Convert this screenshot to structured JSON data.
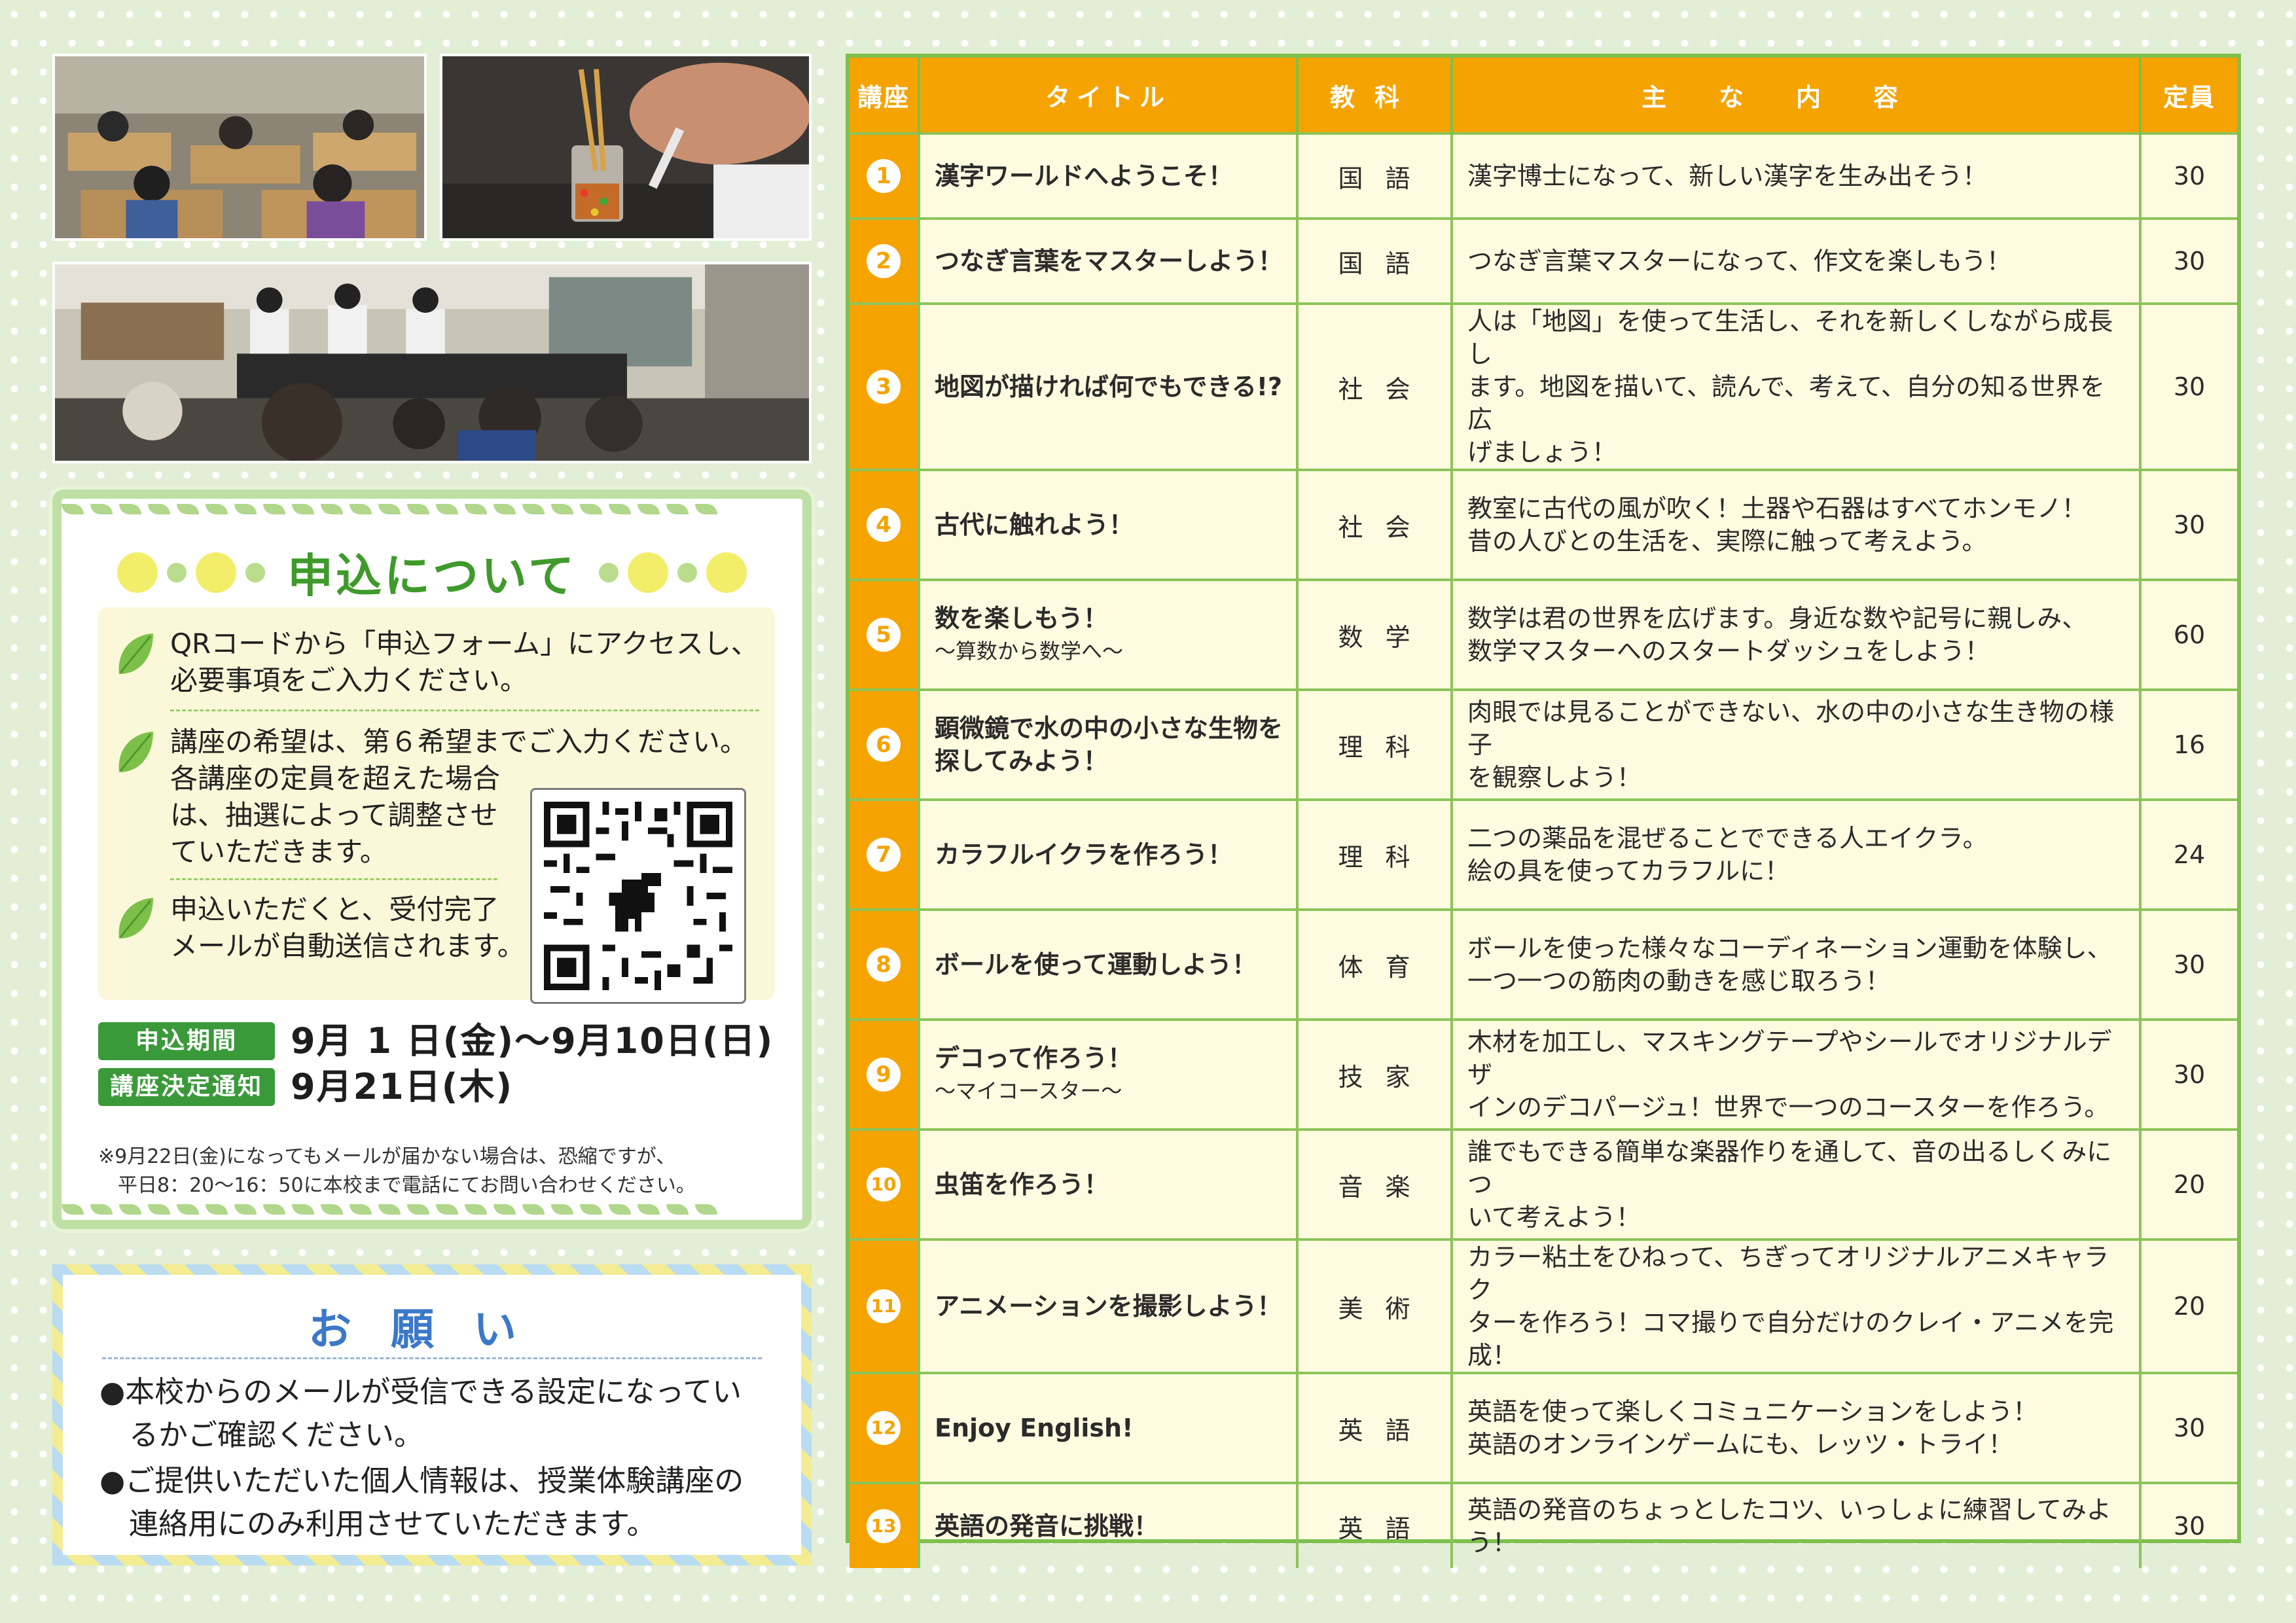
{
  "apply": {
    "title": "申込について",
    "instructions": [
      [
        "QRコードから「申込フォーム」にアクセスし、",
        "必要事項をご入力ください。"
      ],
      [
        "講座の希望は、第６希望までご入力ください。",
        "各講座の定員を超えた場合",
        "は、抽選によって調整させ",
        "ていただきます。"
      ],
      [
        "申込いただくと、受付完了",
        "メールが自動送信されます。"
      ]
    ],
    "period_label": "申込期間",
    "period_value": "9月 1 日(金)～9月10日(日)",
    "notify_label": "講座決定通知",
    "notify_value": "9月21日(木)",
    "notice": [
      "※9月22日(金)になってもメールが届かない場合は、恐縮ですが、",
      "　平日8：20～16：50に本校まで電話にてお問い合わせください。"
    ]
  },
  "request": {
    "title": "お願い",
    "items": [
      [
        "●本校からのメールが受信できる設定になってい",
        "るかご確認ください。"
      ],
      [
        "●ご提供いただいた個人情報は、授業体験講座の",
        "連絡用にのみ利用させていただきます。"
      ]
    ]
  },
  "table": {
    "headers": [
      "講座",
      "タイトル",
      "教科",
      "主な内容",
      "定員"
    ],
    "rows": [
      {
        "num": "1",
        "title": [
          "漢字ワールドへようこそ！"
        ],
        "subject": "国語",
        "content": [
          "漢字博士になって、新しい漢字を生み出そう！"
        ],
        "capacity": "30"
      },
      {
        "num": "2",
        "title": [
          "つなぎ言葉をマスターしよう！"
        ],
        "subject": "国語",
        "content": [
          "つなぎ言葉マスターになって、作文を楽しもう！"
        ],
        "capacity": "30"
      },
      {
        "num": "3",
        "title": [
          "地図が描ければ何でもできる!?"
        ],
        "subject": "社会",
        "content": [
          "人は「地図」を使って生活し、それを新しくしながら成長し",
          "ます。地図を描いて、読んで、考えて、自分の知る世界を広",
          "げましょう！"
        ],
        "capacity": "30"
      },
      {
        "num": "4",
        "title": [
          "古代に触れよう！"
        ],
        "subject": "社会",
        "content": [
          "教室に古代の風が吹く！土器や石器はすべてホンモノ！",
          "昔の人びとの生活を、実際に触って考えよう。"
        ],
        "capacity": "30"
      },
      {
        "num": "5",
        "title": [
          "数を楽しもう！"
        ],
        "subtitle": "～算数から数学へ～",
        "subject": "数学",
        "content": [
          "数学は君の世界を広げます。身近な数や記号に親しみ、",
          "数学マスターへのスタートダッシュをしよう！"
        ],
        "capacity": "60"
      },
      {
        "num": "6",
        "title": [
          "顕微鏡で水の中の小さな生物を",
          "探してみよう！"
        ],
        "subject": "理科",
        "content": [
          "肉眼では見ることができない、水の中の小さな生き物の様子",
          "を観察しよう！"
        ],
        "capacity": "16"
      },
      {
        "num": "7",
        "title": [
          "カラフルイクラを作ろう！"
        ],
        "subject": "理科",
        "content": [
          "二つの薬品を混ぜることでできる人エイクラ。",
          "絵の具を使ってカラフルに！"
        ],
        "capacity": "24"
      },
      {
        "num": "8",
        "title": [
          "ボールを使って運動しよう！"
        ],
        "subject": "体育",
        "content": [
          "ボールを使った様々なコーディネーション運動を体験し、",
          "一つ一つの筋肉の動きを感じ取ろう！"
        ],
        "capacity": "30"
      },
      {
        "num": "9",
        "title": [
          "デコって作ろう！"
        ],
        "subtitle": "～マイコースター～",
        "subject": "技家",
        "content": [
          "木材を加工し、マスキングテープやシールでオリジナルデザ",
          "インのデコパージュ！世界で一つのコースターを作ろう。"
        ],
        "capacity": "30"
      },
      {
        "num": "10",
        "title": [
          "虫笛を作ろう！"
        ],
        "subject": "音楽",
        "content": [
          "誰でもできる簡単な楽器作りを通して、音の出るしくみにつ",
          "いて考えよう！"
        ],
        "capacity": "20"
      },
      {
        "num": "11",
        "title": [
          "アニメーションを撮影しよう！"
        ],
        "subject": "美術",
        "content": [
          "カラー粘土をひねって、ちぎってオリジナルアニメキャラク",
          "ターを作ろう！コマ撮りで自分だけのクレイ・アニメを完成！"
        ],
        "capacity": "20"
      },
      {
        "num": "12",
        "title": [
          "Enjoy English!"
        ],
        "subject": "英語",
        "content": [
          "英語を使って楽しくコミュニケーションをしよう！",
          "英語のオンラインゲームにも、レッツ・トライ！"
        ],
        "capacity": "30"
      },
      {
        "num": "13",
        "title": [
          "英語の発音に挑戦！"
        ],
        "subject": "英語",
        "content": [
          "英語の発音のちょっとしたコツ、いっしょに練習してみよう！"
        ],
        "capacity": "30"
      }
    ]
  },
  "colors": {
    "accent": "#f5a300",
    "green": "#3f9a2b",
    "table_border": "#7ec04d",
    "request_blue": "#3c78c8"
  },
  "icons": [
    "leaf-icon",
    "qr-code-icon"
  ]
}
